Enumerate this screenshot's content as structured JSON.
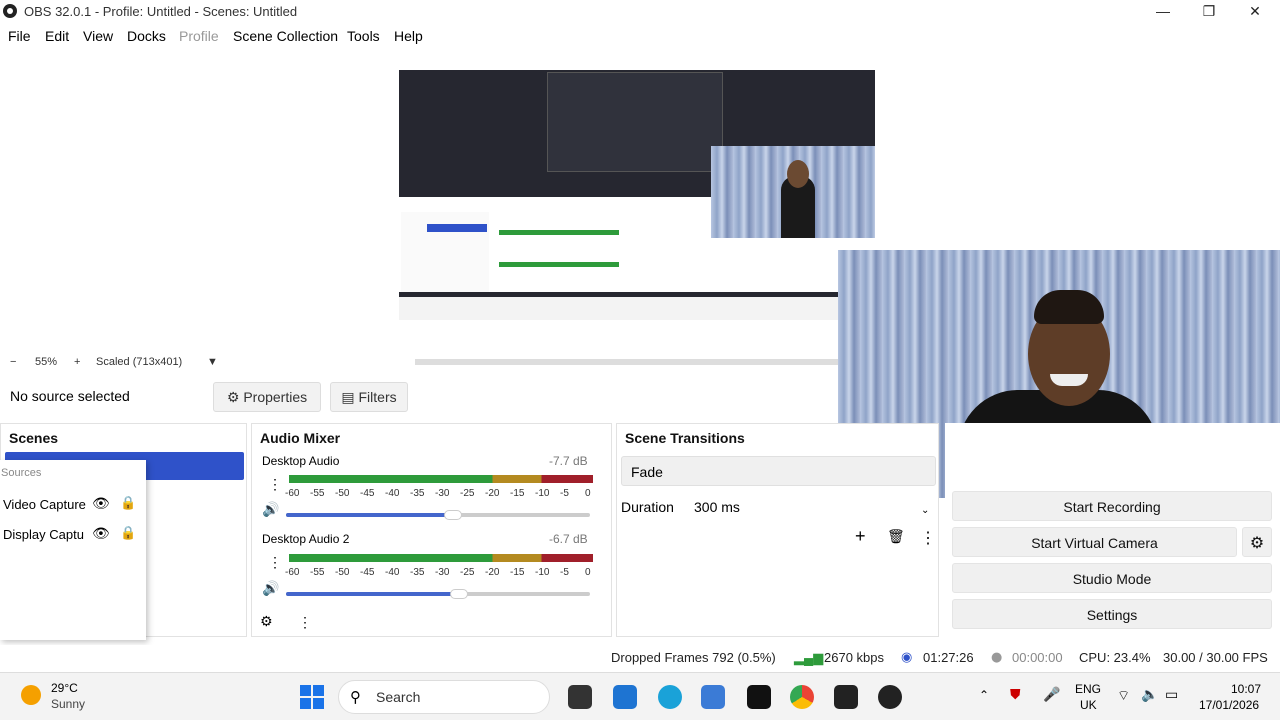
{
  "window": {
    "title": "OBS 32.0.1 - Profile: Untitled - Scenes: Untitled"
  },
  "menu": [
    "File",
    "Edit",
    "View",
    "Docks",
    "Profile",
    "Scene Collection",
    "Tools",
    "Help"
  ],
  "zoom": {
    "minus": "−",
    "level": "55%",
    "plus": "+",
    "scaled": "Scaled (713x401)"
  },
  "context": {
    "no_source": "No source selected",
    "properties": "Properties",
    "filters": "Filters"
  },
  "scenes": {
    "title": "Scenes"
  },
  "sources": {
    "title": "Sources",
    "items": [
      "Video Capturе",
      "Display Captu"
    ]
  },
  "mixer": {
    "title": "Audio Mixer",
    "channels": [
      {
        "name": "Desktop Audio",
        "db": "-7.7 dB",
        "level": 0.55
      },
      {
        "name": "Desktop Audio 2",
        "db": "-6.7 dB",
        "level": 0.57
      }
    ],
    "ticks": [
      "-60",
      "-55",
      "-50",
      "-45",
      "-40",
      "-35",
      "-30",
      "-25",
      "-20",
      "-15",
      "-10",
      "-5",
      "0"
    ]
  },
  "transitions": {
    "title": "Scene Transitions",
    "selected": "Fade",
    "duration_label": "Duration",
    "duration_value": "300 ms"
  },
  "controls": {
    "recording": "Start Recording",
    "virtual_camera": "Start Virtual Camera",
    "studio_mode": "Studio Mode",
    "settings": "Settings"
  },
  "status": {
    "dropped": "Dropped Frames 792 (0.5%)",
    "bitrate": "2670 kbps",
    "rec_time": "01:27:26",
    "stream_time": "00:00:00",
    "cpu": "CPU: 23.4%",
    "fps": "30.00 / 30.00 FPS"
  },
  "taskbar": {
    "temp": "29°C",
    "weather": "Sunny",
    "search": "Search",
    "lang": "ENG",
    "region": "UK",
    "time": "10:07",
    "date": "17/01/2026"
  },
  "colors": {
    "accent": "#2f52c9",
    "meter_green": "#2e9b3b",
    "meter_yellow": "#b48a20",
    "meter_red": "#a01f2a"
  }
}
